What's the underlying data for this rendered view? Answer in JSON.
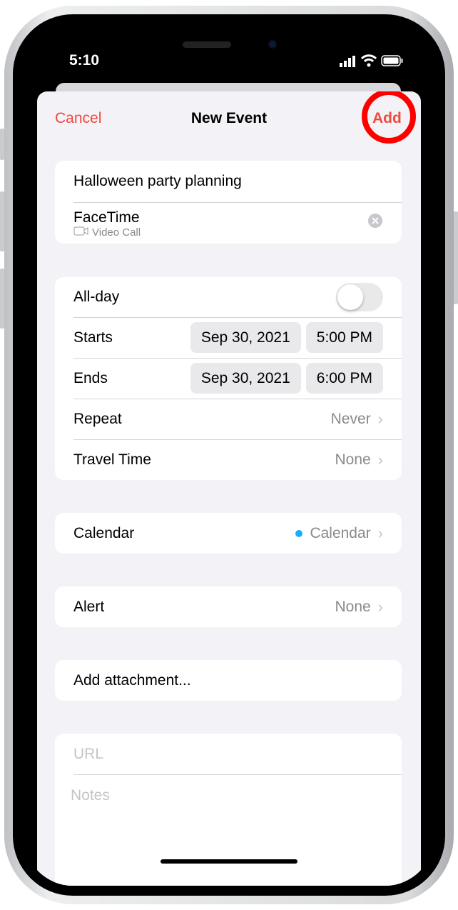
{
  "status": {
    "time": "5:10"
  },
  "nav": {
    "cancel": "Cancel",
    "title": "New Event",
    "add": "Add",
    "highlight_color": "#ff0000",
    "accent": "#f04b3e"
  },
  "event": {
    "title": "Halloween party planning",
    "location": "FaceTime",
    "location_sub": "Video Call"
  },
  "times": {
    "allday_label": "All-day",
    "allday_on": false,
    "starts_label": "Starts",
    "starts_date": "Sep 30, 2021",
    "starts_time": "5:00 PM",
    "ends_label": "Ends",
    "ends_date": "Sep 30, 2021",
    "ends_time": "6:00 PM",
    "repeat_label": "Repeat",
    "repeat_value": "Never",
    "travel_label": "Travel Time",
    "travel_value": "None"
  },
  "calendar": {
    "label": "Calendar",
    "value": "Calendar",
    "dot_color": "#1badf8"
  },
  "alert": {
    "label": "Alert",
    "value": "None"
  },
  "attachment": {
    "label": "Add attachment..."
  },
  "fields": {
    "url_placeholder": "URL",
    "notes_placeholder": "Notes"
  }
}
